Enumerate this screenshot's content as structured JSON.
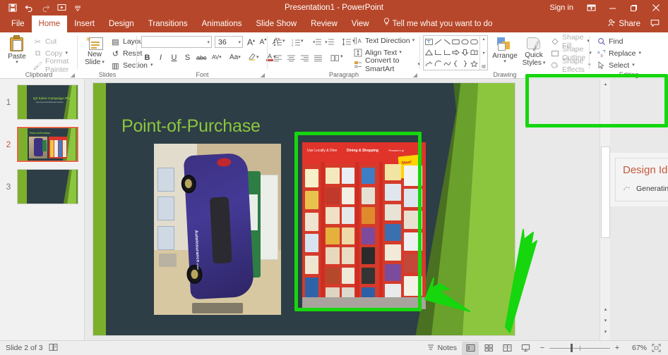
{
  "titlebar": {
    "document_title": "Presentation1  -  PowerPoint",
    "quick_access": [
      {
        "name": "save",
        "glyph": "ὋE"
      },
      {
        "name": "undo",
        "glyph": "↶"
      },
      {
        "name": "redo",
        "glyph": "↷"
      },
      {
        "name": "start-from-beginning",
        "glyph": "▷"
      },
      {
        "name": "customize-qat",
        "glyph": "☰"
      }
    ],
    "sign_in": "Sign in",
    "ribbon_display_options": "⬛",
    "minimize": "—",
    "restore": "❐",
    "close": "✕"
  },
  "tabs": [
    {
      "label": "File",
      "active": false
    },
    {
      "label": "Home",
      "active": true
    },
    {
      "label": "Insert",
      "active": false
    },
    {
      "label": "Design",
      "active": false
    },
    {
      "label": "Transitions",
      "active": false
    },
    {
      "label": "Animations",
      "active": false
    },
    {
      "label": "Slide Show",
      "active": false
    },
    {
      "label": "Review",
      "active": false
    },
    {
      "label": "View",
      "active": false
    }
  ],
  "tell_me": "Tell me what you want to do",
  "share": "Share",
  "ribbon": {
    "clipboard": {
      "group_label": "Clipboard",
      "paste": "Paste",
      "cut": "Cut",
      "copy": "Copy",
      "format_painter": "Format Painter"
    },
    "slides": {
      "group_label": "Slides",
      "new_slide": "New\nSlide",
      "new_slide_line1": "New",
      "new_slide_line2": "Slide",
      "layout": "Layout",
      "reset": "Reset",
      "section": "Section"
    },
    "font": {
      "group_label": "Font",
      "font_name_value": "",
      "font_name_placeholder": "",
      "font_size_value": "36",
      "grow_font": "A",
      "shrink_font": "A",
      "clear_formatting": "✐",
      "bold": "B",
      "italic": "I",
      "underline": "U",
      "shadow": "S",
      "strikethrough": "abc",
      "character_spacing": "AV",
      "change_case": "Aa",
      "text_highlight": "✎",
      "font_color": "A"
    },
    "paragraph": {
      "group_label": "Paragraph",
      "text_direction": "Text Direction",
      "align_text": "Align Text",
      "convert_to_smartart": "Convert to SmartArt"
    },
    "drawing": {
      "group_label": "Drawing",
      "arrange": "Arrange",
      "quick_styles_line1": "Quick",
      "quick_styles_line2": "Styles",
      "shape_fill": "Shape Fill",
      "shape_outline": "Shape Outline",
      "shape_effects": "Shape Effects",
      "shapes": [
        "⌸",
        "╲",
        "↘",
        "▭",
        "◯",
        "▢",
        "△",
        "⌙",
        "⌐",
        "⇨",
        "⇩",
        "⌷",
        "⚡",
        "⌒",
        "∿",
        "｛",
        "｝",
        "☆"
      ]
    },
    "editing": {
      "group_label": "Editing",
      "find": "Find",
      "replace": "Replace",
      "select": "Select"
    }
  },
  "thumbnails": [
    {
      "number": "1",
      "title": "Q3 Sales Campaign Plan",
      "subtitle": "New Automated Business Search",
      "selected": false
    },
    {
      "number": "2",
      "title": "Point-of-Purchase",
      "subtitle": "",
      "selected": true
    },
    {
      "number": "3",
      "title": "",
      "subtitle": "",
      "selected": false
    }
  ],
  "slide": {
    "title": "Point-of-Purchase",
    "title_color": "#8cc63e",
    "background_color": "#2d3e46",
    "accent_color": "#7cb02c",
    "images": [
      {
        "name": "auto-insurance-car-kiosk",
        "alt_text": "AutoInsurance.com car-shaped display kiosk in store aisle",
        "selected": false
      },
      {
        "name": "gift-card-rack",
        "alt_text": "Red point-of-purchase gift card display rack",
        "selected": true
      }
    ]
  },
  "annotations": {
    "highlight_color": "#16d60d",
    "boxes": [
      "selected-picture",
      "design-ideas-pane"
    ],
    "arrows": [
      "arrow-to-picture",
      "arrow-to-design-ideas"
    ]
  },
  "design_ideas": {
    "title": "Design Ideas",
    "status": "Generating Design Ideas...",
    "collapse": "▾",
    "close": "✕"
  },
  "statusbar": {
    "slide_indicator": "Slide 2 of 3",
    "accessibility_icon": "⧉",
    "notes": "Notes",
    "views": [
      {
        "name": "normal-view",
        "glyph": "▣",
        "active": true
      },
      {
        "name": "slide-sorter-view",
        "glyph": "⌸",
        "active": false
      },
      {
        "name": "reading-view",
        "glyph": "▥",
        "active": false
      },
      {
        "name": "slide-show-view",
        "glyph": "□",
        "active": false
      }
    ],
    "zoom_out": "−",
    "zoom_in": "+",
    "zoom_level": "67%",
    "fit_to_window": "⛶"
  }
}
